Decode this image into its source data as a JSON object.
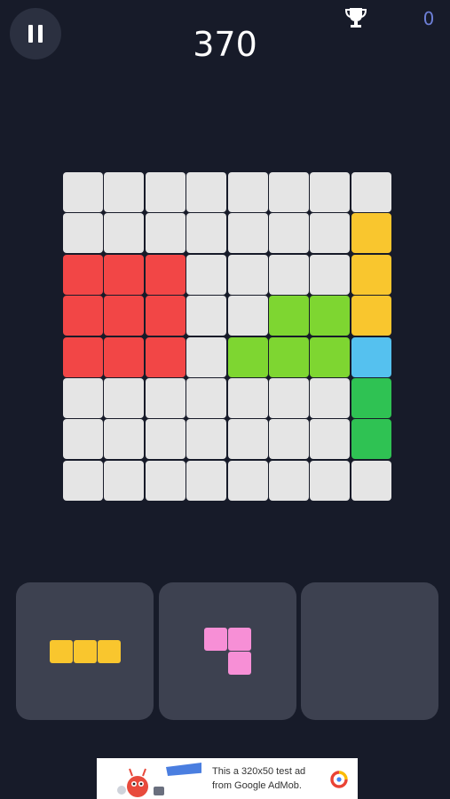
{
  "header": {
    "score": "370",
    "best_score": "0",
    "pause_icon": "pause-icon",
    "trophy_icon": "trophy-icon"
  },
  "colors": {
    "background": "#171b29",
    "empty": "#e5e5e5",
    "R": "#f24646",
    "Y": "#f9c62e",
    "G": "#7ed631",
    "B": "#55c1ef",
    "D": "#2fc253",
    "P": "#f78fd6",
    "tray": "#3d4150"
  },
  "board": {
    "rows": [
      "........",
      ".......Y",
      "RRR....Y",
      "RRR..GGY",
      "RRR.GGGB",
      ".......D",
      ".......D",
      "........"
    ]
  },
  "tray": {
    "pieces": [
      {
        "color": "Y",
        "shape": [
          "###"
        ]
      },
      {
        "color": "P",
        "shape": [
          "##",
          ".#"
        ]
      },
      null
    ]
  },
  "ad": {
    "line1": "This a 320x50 test ad",
    "line2": "from Google AdMob."
  }
}
